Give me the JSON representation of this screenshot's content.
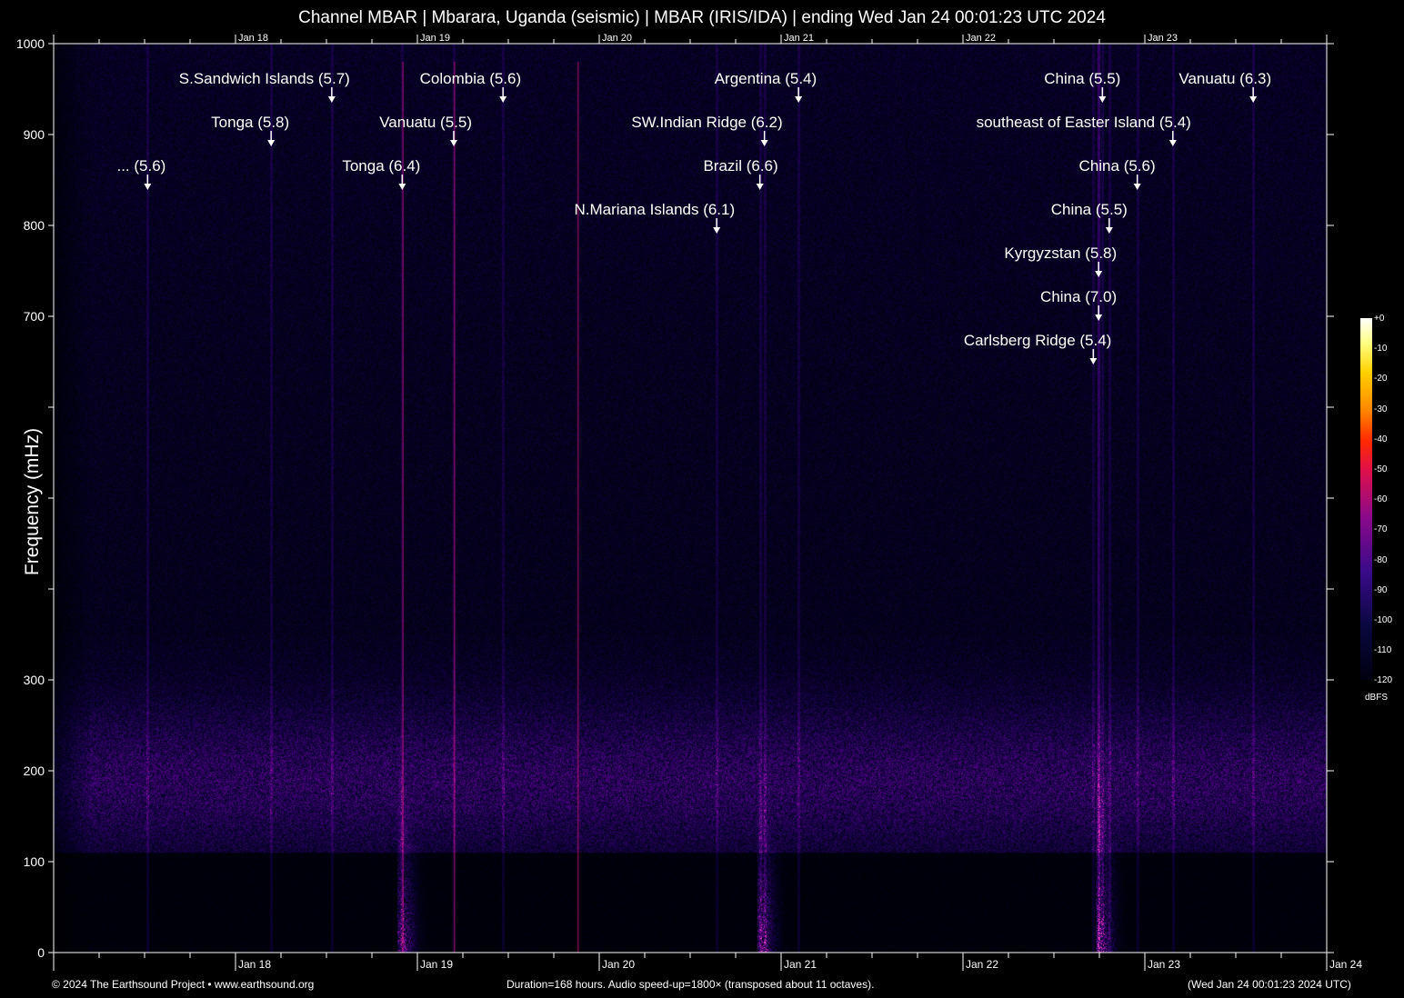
{
  "chart_data": {
    "type": "heatmap",
    "title": "Channel MBAR | Mbarara, Uganda (seismic) | MBAR (IRIS/IDA) | ending Wed Jan 24 00:01:23 UTC 2024",
    "ylabel": "Frequency (mHz)",
    "xlabel": "",
    "ylim": [
      0,
      1000
    ],
    "y_ticks": [
      0,
      100,
      200,
      300,
      400,
      500,
      600,
      700,
      800,
      900,
      1000
    ],
    "y_tick_labels": [
      "0",
      "100",
      "200",
      "300",
      "",
      "",
      "",
      "700",
      "800",
      "900",
      "1000"
    ],
    "xlim_hours": [
      0,
      168
    ],
    "x_tick_labels": [
      {
        "label": "Jan 18",
        "hour": 24
      },
      {
        "label": "Jan 19",
        "hour": 48
      },
      {
        "label": "Jan 20",
        "hour": 72
      },
      {
        "label": "Jan 21",
        "hour": 96
      },
      {
        "label": "Jan 22",
        "hour": 120
      },
      {
        "label": "Jan 23",
        "hour": 144
      },
      {
        "label": "Jan 24",
        "hour": 168
      }
    ],
    "colorbar": {
      "label": "dBFS",
      "ticks": [
        "+0",
        "-10",
        "-20",
        "-30",
        "-40",
        "-50",
        "-60",
        "-70",
        "-80",
        "-90",
        "-100",
        "-110",
        "-120"
      ],
      "range": [
        -120,
        0
      ]
    },
    "events": [
      {
        "label": "... (5.6)",
        "hour": 12.4
      },
      {
        "label": "S.Sandwich Islands (5.7)",
        "hour": 36.7
      },
      {
        "label": "Tonga (5.8)",
        "hour": 28.7
      },
      {
        "label": "Tonga (6.4)",
        "hour": 46.0
      },
      {
        "label": "Vanuatu (5.5)",
        "hour": 52.8
      },
      {
        "label": "Colombia (5.6)",
        "hour": 59.3
      },
      {
        "label": "N.Mariana Islands (6.1)",
        "hour": 87.5
      },
      {
        "label": "SW.Indian Ridge (6.2)",
        "hour": 93.8
      },
      {
        "label": "Brazil (6.6)",
        "hour": 93.2
      },
      {
        "label": "Argentina (5.4)",
        "hour": 98.3
      },
      {
        "label": "China (5.5)",
        "hour": 138.4
      },
      {
        "label": "southeast of Easter Island (5.4)",
        "hour": 147.7
      },
      {
        "label": "China (5.6)",
        "hour": 143.0
      },
      {
        "label": "China (5.5)",
        "hour": 139.3
      },
      {
        "label": "Kyrgyzstan (5.8)",
        "hour": 137.9
      },
      {
        "label": "China (7.0)",
        "hour": 137.9
      },
      {
        "label": "Carlsberg Ridge (5.4)",
        "hour": 137.2
      },
      {
        "label": "Vanuatu (6.3)",
        "hour": 158.3
      }
    ]
  },
  "footer": {
    "copyright": "© 2024 The Earthsound Project • www.earthsound.org",
    "info": "Duration=168 hours. Audio speed-up=1800× (transposed about 11 octaves).",
    "timestamp": "(Wed Jan 24 00:01:23 2024 UTC)"
  }
}
